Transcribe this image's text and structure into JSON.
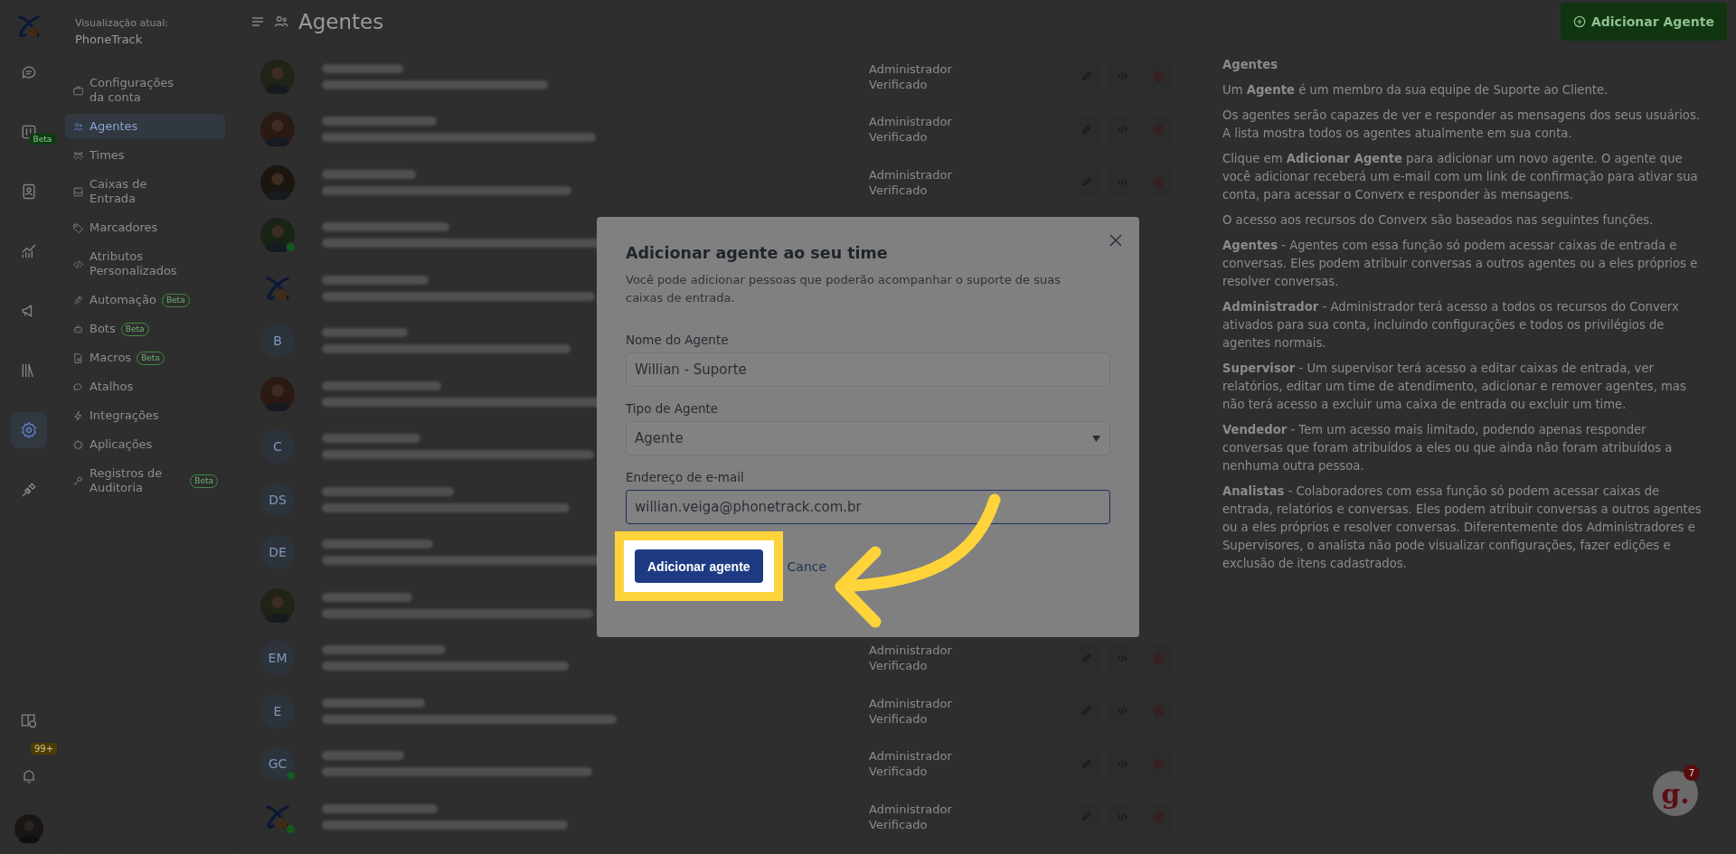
{
  "rail": {
    "items": [
      {
        "kind": "chat",
        "selected": false
      },
      {
        "kind": "kanban",
        "selected": false,
        "badge": "Beta"
      },
      {
        "kind": "contacts",
        "selected": false
      },
      {
        "kind": "reports",
        "selected": false
      },
      {
        "kind": "campaigns",
        "selected": false
      },
      {
        "kind": "library",
        "selected": false
      },
      {
        "kind": "settings",
        "selected": true
      },
      {
        "kind": "plug",
        "selected": false
      }
    ],
    "notifications_badge": "99+"
  },
  "account": {
    "label": "Visualização atual:",
    "name": "PhoneTrack"
  },
  "menu": [
    {
      "kind": "briefcase",
      "label": "Configurações da conta",
      "selected": false
    },
    {
      "kind": "people",
      "label": "Agentes",
      "selected": true
    },
    {
      "kind": "team",
      "label": "Times",
      "selected": false
    },
    {
      "kind": "inbox",
      "label": "Caixas de Entrada",
      "selected": false
    },
    {
      "kind": "tag",
      "label": "Marcadores",
      "selected": false
    },
    {
      "kind": "code",
      "label": "Atributos Personalizados",
      "selected": false
    },
    {
      "kind": "plug",
      "label": "Automação",
      "selected": false,
      "badge": "Beta"
    },
    {
      "kind": "bot",
      "label": "Bots",
      "selected": false,
      "badge": "Beta"
    },
    {
      "kind": "macro",
      "label": "Macros",
      "selected": false,
      "badge": "Beta"
    },
    {
      "kind": "chat",
      "label": "Atalhos",
      "selected": false
    },
    {
      "kind": "bolt",
      "label": "Integrações",
      "selected": false
    },
    {
      "kind": "apps",
      "label": "Aplicações",
      "selected": false
    },
    {
      "kind": "key",
      "label": "Registros de Auditoria",
      "selected": false,
      "badge": "Beta"
    }
  ],
  "header": {
    "title": "Agentes",
    "add_button": "Adicionar Agente"
  },
  "agents": [
    {
      "kind": "photo",
      "online": false,
      "role": "Administrador",
      "status": "Verificado"
    },
    {
      "kind": "photo",
      "online": false,
      "role": "Administrador",
      "status": "Verificado"
    },
    {
      "kind": "photo",
      "online": false,
      "role": "Administrador",
      "status": "Verificado"
    },
    {
      "kind": "photo",
      "online": true
    },
    {
      "kind": "logo",
      "online": false
    },
    {
      "kind": "initials",
      "initials": "B",
      "online": false
    },
    {
      "kind": "photo",
      "online": false
    },
    {
      "kind": "initials",
      "initials": "C",
      "online": false
    },
    {
      "kind": "initials",
      "initials": "DS",
      "online": false
    },
    {
      "kind": "initials",
      "initials": "DE",
      "online": false
    },
    {
      "kind": "photo",
      "online": false
    },
    {
      "kind": "initials",
      "initials": "EM",
      "online": false,
      "role": "Administrador",
      "status": "Verificado"
    },
    {
      "kind": "initials",
      "initials": "E",
      "online": false,
      "role": "Administrador",
      "status": "Verificado"
    },
    {
      "kind": "initials",
      "initials": "GC",
      "online": true,
      "role": "Administrador",
      "status": "Verificado"
    },
    {
      "kind": "logo",
      "online": true,
      "role": "Administrador",
      "status": "Verificado"
    }
  ],
  "help": {
    "title": "Agentes",
    "paragraphs": [
      "Um **Agente** é um membro da sua equipe de Suporte ao Cliente.",
      "Os agentes serão capazes de ver e responder as mensagens dos seus usuários. A lista mostra todos os agentes atualmente em sua conta.",
      "Clique em **Adicionar Agente** para adicionar um novo agente. O agente que você adicionar receberá um e-mail com um link de confirmação para ativar sua conta, para acessar o Converx e responder às mensagens.",
      "O acesso aos recursos do Converx são baseados nas seguintes funções.",
      "**Agentes** - Agentes com essa função só podem acessar caixas de entrada e conversas. Eles podem atribuir conversas a outros agentes ou a eles próprios e resolver conversas.",
      "**Administrador** - Administrador terá acesso a todos os recursos do Converx ativados para sua conta, incluindo configurações e todos os privilégios de agentes normais.",
      "**Supervisor** - Um supervisor terá acesso a editar caixas de entrada, ver relatórios, editar um time de atendimento, adicionar e remover agentes, mas não terá acesso a excluir uma caixa de entrada ou excluir um time.",
      "**Vendedor** - Tem um acesso mais limitado, podendo apenas responder conversas que foram atribuídos a eles ou que ainda não foram atribuídos a nenhuma outra pessoa.",
      "**Analistas** - Colaboradores com essa função só podem acessar caixas de entrada, relatórios e conversas. Eles podem atribuir conversas a outros agentes ou a eles próprios e resolver conversas. Diferentemente dos Administradores e Supervisores, o analista não pode visualizar configurações, fazer edições e exclusão de itens cadastrados."
    ]
  },
  "modal": {
    "title": "Adicionar agente ao seu time",
    "description": "Você pode adicionar pessoas que poderão acompanhar o suporte de suas caixas de entrada.",
    "fields": [
      {
        "kind": "text",
        "label": "Nome do Agente",
        "value": "Willian - Suporte",
        "focused": false
      },
      {
        "kind": "select",
        "label": "Tipo de Agente",
        "value": "Agente",
        "focused": false
      },
      {
        "kind": "text",
        "label": "Endereço de e-mail",
        "value": "willian.veiga@phonetrack.com.br",
        "focused": true
      }
    ],
    "submit": "Adicionar agente",
    "cancel": "Cance"
  },
  "chat_widget": {
    "logo": "g.",
    "badge": "7"
  }
}
